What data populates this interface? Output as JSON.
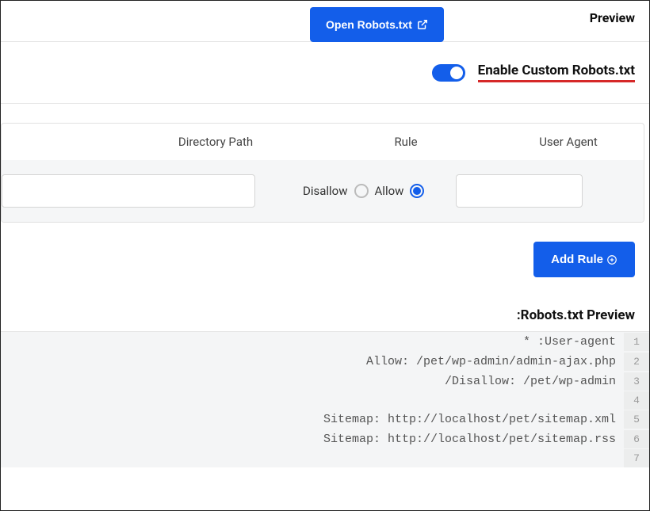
{
  "top": {
    "open_robots_label": "Open Robots.txt",
    "preview_label": "Preview"
  },
  "enable": {
    "label": "Enable Custom Robots.txt"
  },
  "table": {
    "headers": {
      "dir": "Directory Path",
      "rule": "Rule",
      "agent": "User Agent"
    },
    "rule_options": {
      "disallow": "Disallow",
      "allow": "Allow"
    }
  },
  "add_rule_label": "Add Rule",
  "preview_heading": ":Robots.txt Preview",
  "code_lines": [
    "* :User-agent",
    "Allow: /pet/wp-admin/admin-ajax.php",
    "/Disallow: /pet/wp-admin",
    "",
    "Sitemap: http://localhost/pet/sitemap.xml",
    "Sitemap: http://localhost/pet/sitemap.rss",
    ""
  ]
}
